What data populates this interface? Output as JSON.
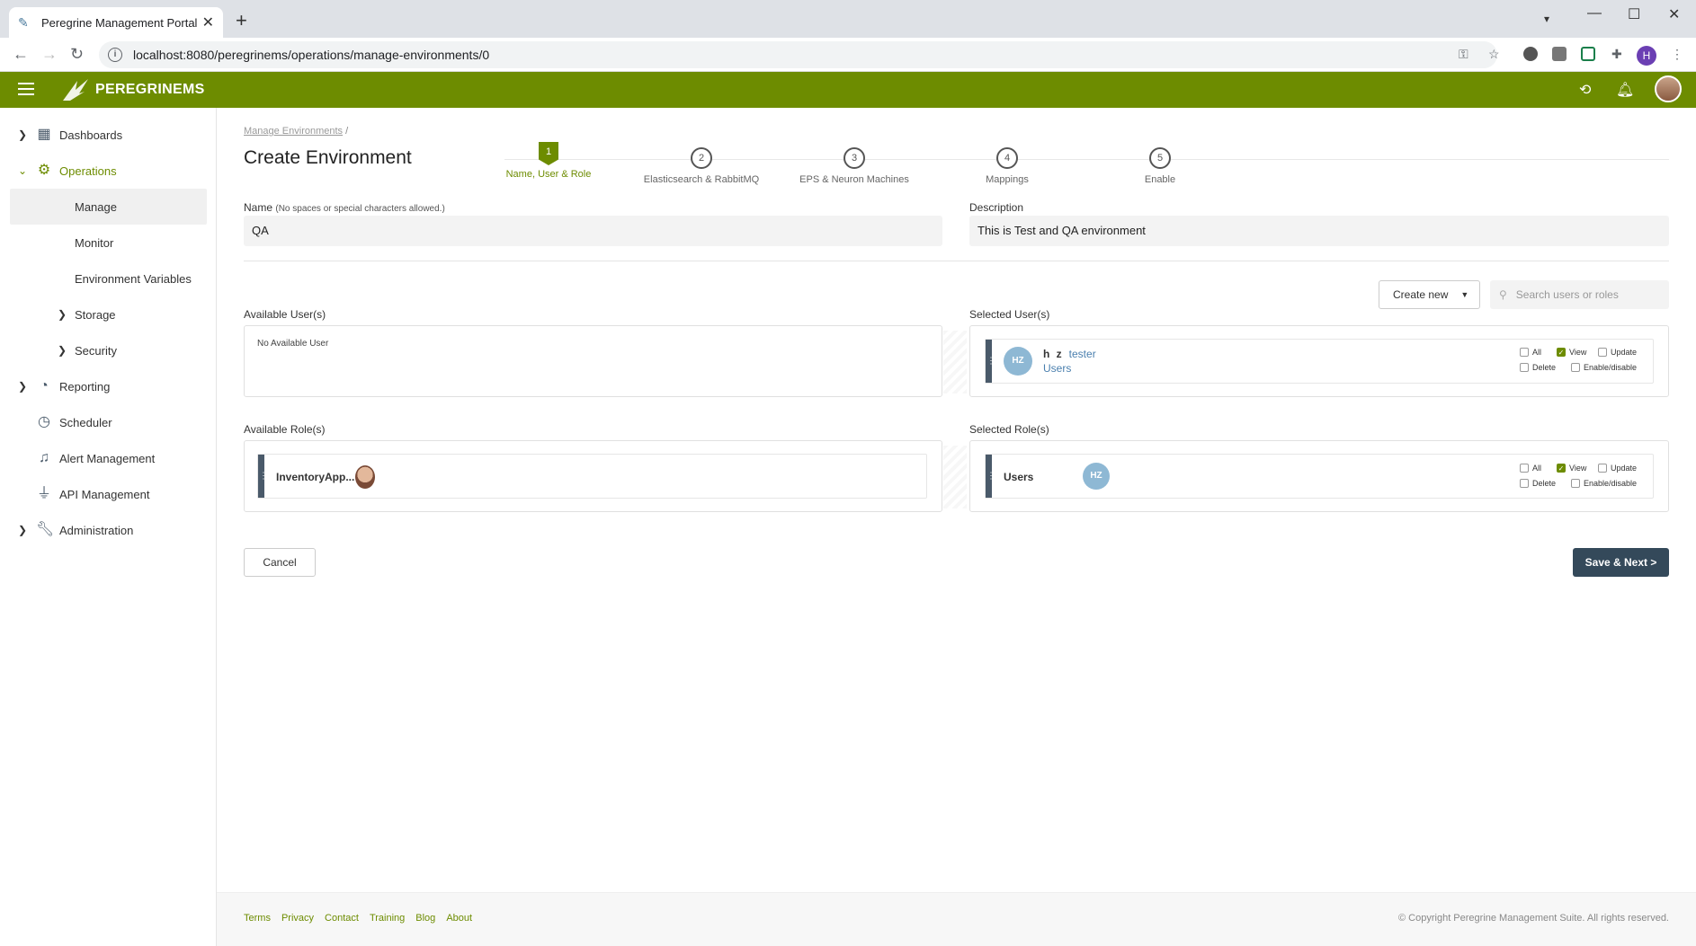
{
  "browser": {
    "tab_title": "Peregrine Management Portal",
    "url": "localhost:8080/peregrinems/operations/manage-environments/0",
    "profile_initial": "H"
  },
  "app": {
    "logo_text": "PEREGRINEMS"
  },
  "sidebar": {
    "items": [
      {
        "label": "Dashboards"
      },
      {
        "label": "Operations"
      },
      {
        "label": "Manage"
      },
      {
        "label": "Monitor"
      },
      {
        "label": "Environment Variables"
      },
      {
        "label": "Storage"
      },
      {
        "label": "Security"
      },
      {
        "label": "Reporting"
      },
      {
        "label": "Scheduler"
      },
      {
        "label": "Alert Management"
      },
      {
        "label": "API Management"
      },
      {
        "label": "Administration"
      }
    ]
  },
  "page": {
    "breadcrumb": "Manage Environments",
    "breadcrumb_sep": "/",
    "title": "Create Environment"
  },
  "steps": [
    {
      "num": "1",
      "label": "Name, User & Role"
    },
    {
      "num": "2",
      "label": "Elasticsearch & RabbitMQ"
    },
    {
      "num": "3",
      "label": "EPS & Neuron Machines"
    },
    {
      "num": "4",
      "label": "Mappings"
    },
    {
      "num": "5",
      "label": "Enable"
    }
  ],
  "form": {
    "name_label": "Name",
    "name_hint": "(No spaces or special characters allowed.)",
    "name_value": "QA",
    "desc_label": "Description",
    "desc_value": "This is Test and QA environment"
  },
  "toolbar": {
    "create_new": "Create new",
    "search_placeholder": "Search users or roles"
  },
  "available_users": {
    "title": "Available User(s)",
    "empty": "No Available User"
  },
  "selected_users": {
    "title": "Selected User(s)",
    "items": [
      {
        "initials": "HZ",
        "name": "h z",
        "username": "tester",
        "role": "Users"
      }
    ]
  },
  "available_roles": {
    "title": "Available Role(s)",
    "items": [
      {
        "name": "InventoryApp..."
      }
    ]
  },
  "selected_roles": {
    "title": "Selected Role(s)",
    "items": [
      {
        "name": "Users",
        "initials": "HZ"
      }
    ]
  },
  "permissions": {
    "all": "All",
    "view": "View",
    "update": "Update",
    "delete": "Delete",
    "enable": "Enable/disable"
  },
  "actions": {
    "cancel": "Cancel",
    "save_next": "Save & Next >"
  },
  "footer": {
    "links": [
      "Terms",
      "Privacy",
      "Contact",
      "Training",
      "Blog",
      "About"
    ],
    "copyright": "© Copyright Peregrine Management Suite. All rights reserved."
  },
  "colors": {
    "brand": "#6d8c00",
    "dark_button": "#34495a",
    "badge": "#8eb8d4"
  }
}
